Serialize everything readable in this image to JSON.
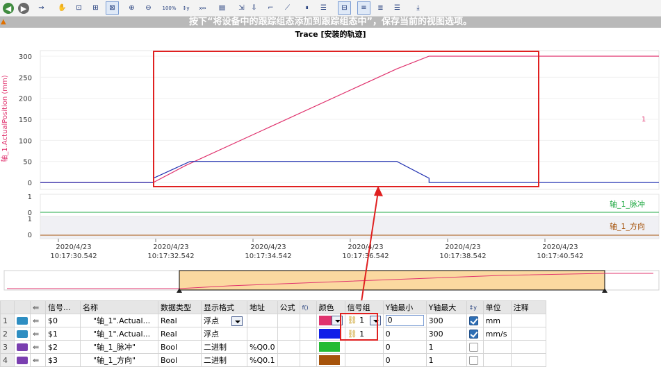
{
  "banner": {
    "text": "按下“将设备中的跟踪组态添加到跟踪组态中”，保存当前的视图选项。"
  },
  "trace": {
    "title": "Trace [安装的轨迹]"
  },
  "toolbar": {
    "icons": [
      "back-icon",
      "forward-icon",
      "signal-icon",
      "hand-icon",
      "zoom-area-icon",
      "zoom-x-icon",
      "zoom-select-icon",
      "zoom-in-icon",
      "zoom-out-icon",
      "zoom-100-icon",
      "y-100-icon",
      "x-100-icon",
      "chart-icon",
      "marker-icon",
      "measure-icon",
      "slope-icon",
      "vertical-cursor-icon",
      "horizontal-cursor-icon",
      "signal-table-icon",
      "list-icon",
      "align-left-icon",
      "align-right-icon",
      "export-icon"
    ]
  },
  "chart_data": [
    {
      "type": "line",
      "ylabel": "轴_1.ActualPosition (mm)",
      "ylim": [
        0,
        300
      ],
      "yticks": [
        "300",
        "250",
        "200",
        "150",
        "100",
        "50",
        "0"
      ],
      "series": [
        {
          "name": "$0",
          "color": "#e0336e",
          "x": [
            "10:17:30.542",
            "10:17:33.0",
            "10:17:33.7",
            "10:17:38.3",
            "10:17:39.0",
            "10:17:44.0"
          ],
          "values": [
            0,
            0,
            40,
            270,
            300,
            300
          ]
        },
        {
          "color": "#1f2fb0",
          "x": [
            "10:17:30.542",
            "10:17:33.0",
            "10:17:33.0",
            "10:17:33.8",
            "10:17:38.3",
            "10:17:39.0",
            "10:17:39.0",
            "10:17:44.0"
          ],
          "values": [
            0,
            0,
            10,
            50,
            50,
            10,
            0,
            0
          ]
        }
      ],
      "right_label": "1"
    },
    {
      "type": "line",
      "ylim": [
        0,
        1
      ],
      "yticks": [
        "1",
        "0"
      ],
      "series": [
        {
          "name": "轴_1_脉冲",
          "values": [
            0,
            0
          ]
        }
      ]
    },
    {
      "type": "line",
      "ylim": [
        0,
        1
      ],
      "yticks": [
        "1",
        "0"
      ],
      "series": [
        {
          "name": "轴_1_方向",
          "values": [
            0,
            0
          ]
        }
      ]
    }
  ],
  "xaxis": {
    "ticks": [
      {
        "date": "2020/4/23",
        "time": "10:17:30.542"
      },
      {
        "date": "2020/4/23",
        "time": "10:17:32.542"
      },
      {
        "date": "2020/4/23",
        "time": "10:17:34.542"
      },
      {
        "date": "2020/4/23",
        "time": "10:17:36.542"
      },
      {
        "date": "2020/4/23",
        "time": "10:17:38.542"
      },
      {
        "date": "2020/4/23",
        "time": "10:17:40.542"
      }
    ]
  },
  "table": {
    "headers": [
      "信号...",
      "名称",
      "数据类型",
      "显示格式",
      "地址",
      "公式",
      "颜色",
      "信号组",
      "Y轴最小",
      "Y轴最大",
      "单位",
      "注释"
    ],
    "rows": [
      {
        "num": "1",
        "sig": "$0",
        "name": "\"轴_1\".Actual...",
        "type": "Real",
        "fmt": "浮点",
        "addr": "",
        "color": "#e0336e",
        "group": "1",
        "ymin": "0",
        "ymax": "300",
        "checked": true,
        "unit": "mm"
      },
      {
        "num": "2",
        "sig": "$1",
        "name": "\"轴_1\".Actual...",
        "type": "Real",
        "fmt": "浮点",
        "addr": "",
        "color": "#1020e8",
        "group": "1",
        "ymin": "0",
        "ymax": "300",
        "checked": true,
        "unit": "mm/s"
      },
      {
        "num": "3",
        "sig": "$2",
        "name": "\"轴_1_脉冲\"",
        "type": "Bool",
        "fmt": "二进制",
        "addr": "%Q0.0",
        "color": "#22bb33",
        "group": "",
        "ymin": "0",
        "ymax": "1",
        "checked": false,
        "unit": ""
      },
      {
        "num": "4",
        "sig": "$3",
        "name": "\"轴_1_方向\"",
        "type": "Bool",
        "fmt": "二进制",
        "addr": "%Q0.1",
        "color": "#a6530b",
        "group": "",
        "ymin": "0",
        "ymax": "1",
        "checked": false,
        "unit": ""
      }
    ]
  }
}
